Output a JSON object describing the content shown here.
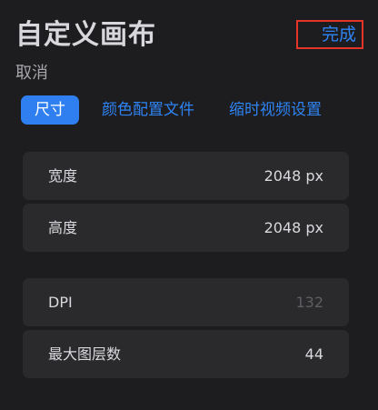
{
  "header": {
    "title": "自定义画布",
    "done_label": "完成",
    "cancel_label": "取消"
  },
  "tabs": [
    {
      "label": "尺寸",
      "active": true
    },
    {
      "label": "颜色配置文件",
      "active": false
    },
    {
      "label": "缩时视频设置",
      "active": false
    }
  ],
  "size_group": {
    "width": {
      "label": "宽度",
      "value": "2048 px"
    },
    "height": {
      "label": "高度",
      "value": "2048 px"
    }
  },
  "info_group": {
    "dpi": {
      "label": "DPI",
      "value": "132"
    },
    "max_layers": {
      "label": "最大图层数",
      "value": "44"
    }
  },
  "colors": {
    "accent": "#2f84f5",
    "tab_active_bg": "#2f7ff0",
    "highlight_border": "#e5352b",
    "background": "#1d1d1f",
    "row_bg": "#2a2a2c"
  }
}
